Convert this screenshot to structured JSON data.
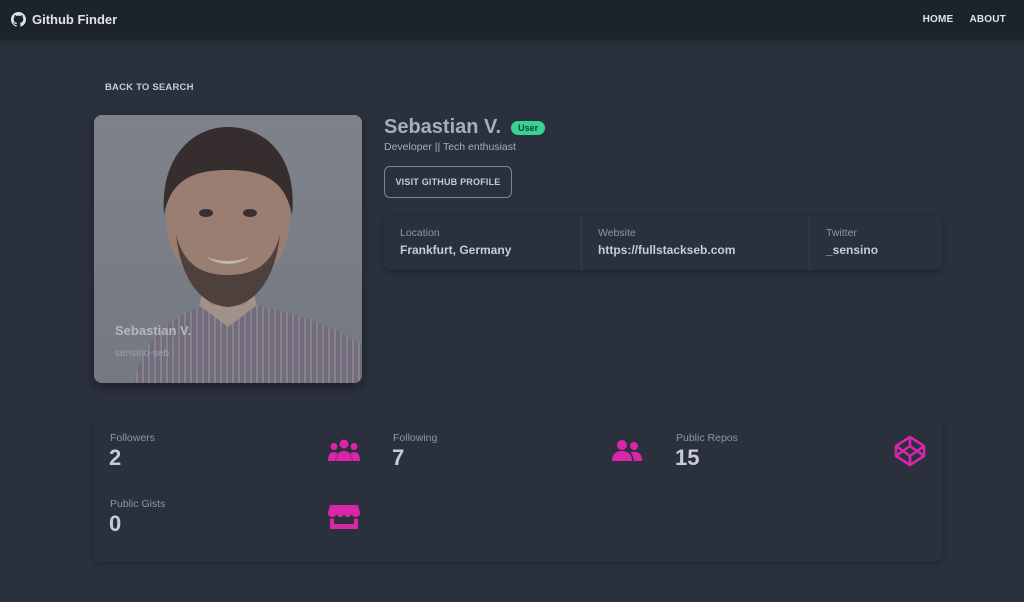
{
  "navbar": {
    "brand": "Github Finder",
    "links": [
      "HOME",
      "ABOUT"
    ]
  },
  "back_link": "BACK TO SEARCH",
  "profile": {
    "name": "Sebastian V.",
    "login": "sensino-seb",
    "type_badge": "User",
    "bio": "Developer || Tech enthusiast",
    "github_button": "VISIT GITHUB PROFILE"
  },
  "info": [
    {
      "label": "Location",
      "value": "Frankfurt, Germany"
    },
    {
      "label": "Website",
      "value": "https://fullstackseb.com"
    },
    {
      "label": "Twitter",
      "value": "_sensino"
    }
  ],
  "counts": [
    {
      "label": "Followers",
      "value": "2",
      "icon": "users-icon"
    },
    {
      "label": "Following",
      "value": "7",
      "icon": "user-friends-icon"
    },
    {
      "label": "Public Repos",
      "value": "15",
      "icon": "codepen-icon"
    },
    {
      "label": "Public Gists",
      "value": "0",
      "icon": "store-icon"
    }
  ],
  "colors": {
    "background": "#2a303c",
    "navbar": "#1d232b",
    "accent": "#d926a9",
    "badge": "#36d399"
  }
}
